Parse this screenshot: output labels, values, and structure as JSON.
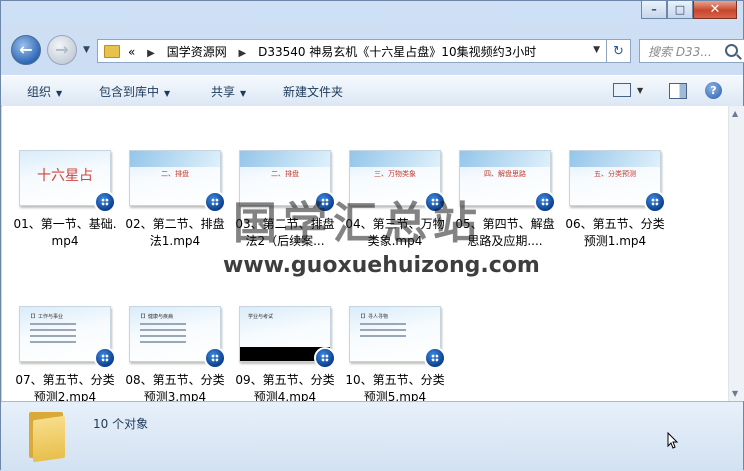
{
  "window": {
    "caption_buttons": [
      "minimize",
      "maximize",
      "close"
    ]
  },
  "address_bar": {
    "overflow": "«",
    "segments": [
      "国学资源网",
      "D33540 神易玄机《十六星占盘》10集视频约3小时"
    ]
  },
  "search": {
    "placeholder": "搜索 D33..."
  },
  "toolbar": {
    "organize": "组织",
    "include_in_library": "包含到库中",
    "share": "共享",
    "new_folder": "新建文件夹"
  },
  "files": [
    {
      "name": "01、第一节、基础.mp4",
      "thumb_title": "十六星占"
    },
    {
      "name": "02、第二节、排盘法1.mp4",
      "thumb_title": "二、排盘"
    },
    {
      "name": "03、第二节、排盘法2（后续案...",
      "thumb_title": "二、排盘"
    },
    {
      "name": "04、第三节、万物类象.mp4",
      "thumb_title": "三、万物类象"
    },
    {
      "name": "05、第四节、解盘思路及应期....",
      "thumb_title": "四、解盘思路"
    },
    {
      "name": "06、第五节、分类预测1.mp4",
      "thumb_title": "五、分类预测"
    },
    {
      "name": "07、第五节、分类预测2.mp4",
      "thumb_title": "【】工作与事业"
    },
    {
      "name": "08、第五节、分类预测3.mp4",
      "thumb_title": "【】健康与疾病"
    },
    {
      "name": "09、第五节、分类预测4.mp4",
      "thumb_title": "学业与考试"
    },
    {
      "name": "10、第五节、分类预测5.mp4",
      "thumb_title": "【】寻人寻物"
    }
  ],
  "watermark": {
    "title": "国学汇总站",
    "url": "www.guoxuehuizong.com"
  },
  "details": {
    "count": "10 个对象"
  }
}
